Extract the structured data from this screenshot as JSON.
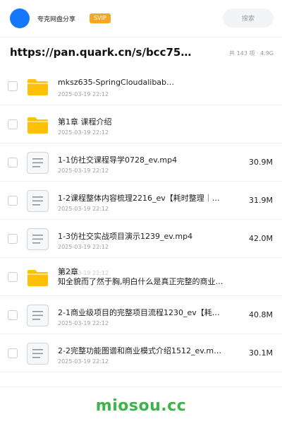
{
  "header": {
    "share_name": "夸克网盘分享",
    "badge": "SVIP",
    "search_placeholder": "搜索"
  },
  "title": {
    "url": "https://pan.quark.cn/s/bcc759c3…",
    "meta": "共 143 项 · 4.9G"
  },
  "files": [
    {
      "type": "folder",
      "name": "mksz635-SpringCloudalibab…",
      "date": "2025-03-19 22:12",
      "size": ""
    },
    {
      "type": "folder",
      "name": "第1章 课程介绍",
      "date": "2025-03-19 22:12",
      "size": ""
    },
    {
      "type": "file",
      "name": "1-1仿社交课程导学0728_ev.mp4",
      "date": "2025-03-19 22:12",
      "size": "30.9M"
    },
    {
      "type": "file",
      "name": "1-2课程整体内容梳理2216_ev【耗时整理｜免…",
      "date": "2025-03-19 22:12",
      "size": "31.9M"
    },
    {
      "type": "file",
      "name": "1-3仿社交实战项目演示1239_ev.mp4",
      "date": "2025-03-19 22:12",
      "size": "42.0M"
    },
    {
      "type": "folder",
      "name": "第2章\n知全貌而了然于胸,明白什么是真正完整的商业…",
      "date": "2025-03-19 22:12",
      "size": ""
    },
    {
      "type": "file",
      "name": "2-1商业级项目的完整项目流程1230_ev【耗时…",
      "date": "2025-03-19 22:12",
      "size": "40.8M"
    },
    {
      "type": "file",
      "name": "2-2完整功能图谱和商业模式介绍1512_ev.m…",
      "date": "2025-03-19 22:12",
      "size": "30.1M"
    }
  ],
  "watermark": "miosou.cc",
  "colors": {
    "accent": "#1677ff",
    "badge": "#f5a623",
    "folder": "#ffc107",
    "watermark": "#3bb54a"
  },
  "icons": {
    "folder": "folder-icon",
    "file": "document-icon"
  }
}
